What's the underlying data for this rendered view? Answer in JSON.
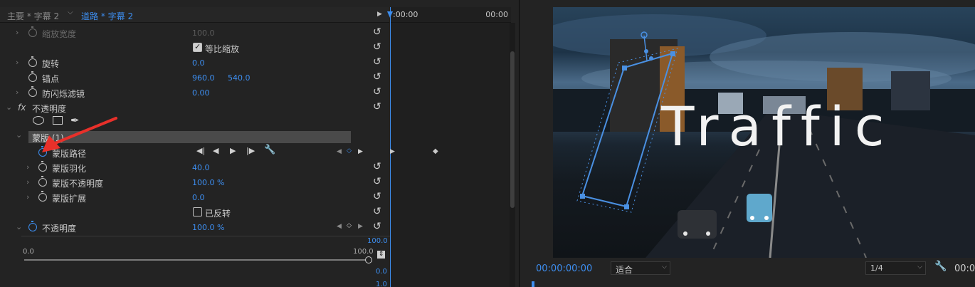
{
  "effect_controls": {
    "tabs": {
      "main_sequence": "主要 * 字幕 2",
      "clip": "道路 * 字幕 2"
    },
    "timeline": {
      "start": ":00:00",
      "end": "00:00"
    },
    "scale_width": {
      "label": "缩放宽度",
      "value": "100.0"
    },
    "uniform_scale": {
      "label": "等比缩放",
      "checked": true
    },
    "rotation": {
      "label": "旋转",
      "value": "0.0"
    },
    "anchor_point": {
      "label": "锚点",
      "x": "960.0",
      "y": "540.0"
    },
    "anti_flicker": {
      "label": "防闪烁滤镜",
      "value": "0.00"
    },
    "opacity_section": {
      "fx": "fx",
      "label": "不透明度"
    },
    "mask": {
      "title": "蒙版 (1)",
      "path_label": "蒙版路径",
      "feather": {
        "label": "蒙版羽化",
        "value": "40.0"
      },
      "opacity": {
        "label": "蒙版不透明度",
        "value": "100.0 %"
      },
      "expansion": {
        "label": "蒙版扩展",
        "value": "0.0"
      },
      "inverted": {
        "label": "已反转",
        "checked": false
      }
    },
    "opacity": {
      "label": "不透明度",
      "value": "100.0 %"
    },
    "graph": {
      "top_value": "100.0",
      "slider_min": "0.0",
      "slider_max": "100.0",
      "bottom_value": "0.0",
      "footer_value": "1.0"
    }
  },
  "program_monitor": {
    "title_text": "Traffic",
    "timecode": "00:00:00:00",
    "fit": "适合",
    "resolution": "1/4",
    "timecode_right": "00:0"
  },
  "colors": {
    "accent": "#3d8ef0",
    "panel_bg": "#232323",
    "annotation_arrow": "#e8302a"
  }
}
